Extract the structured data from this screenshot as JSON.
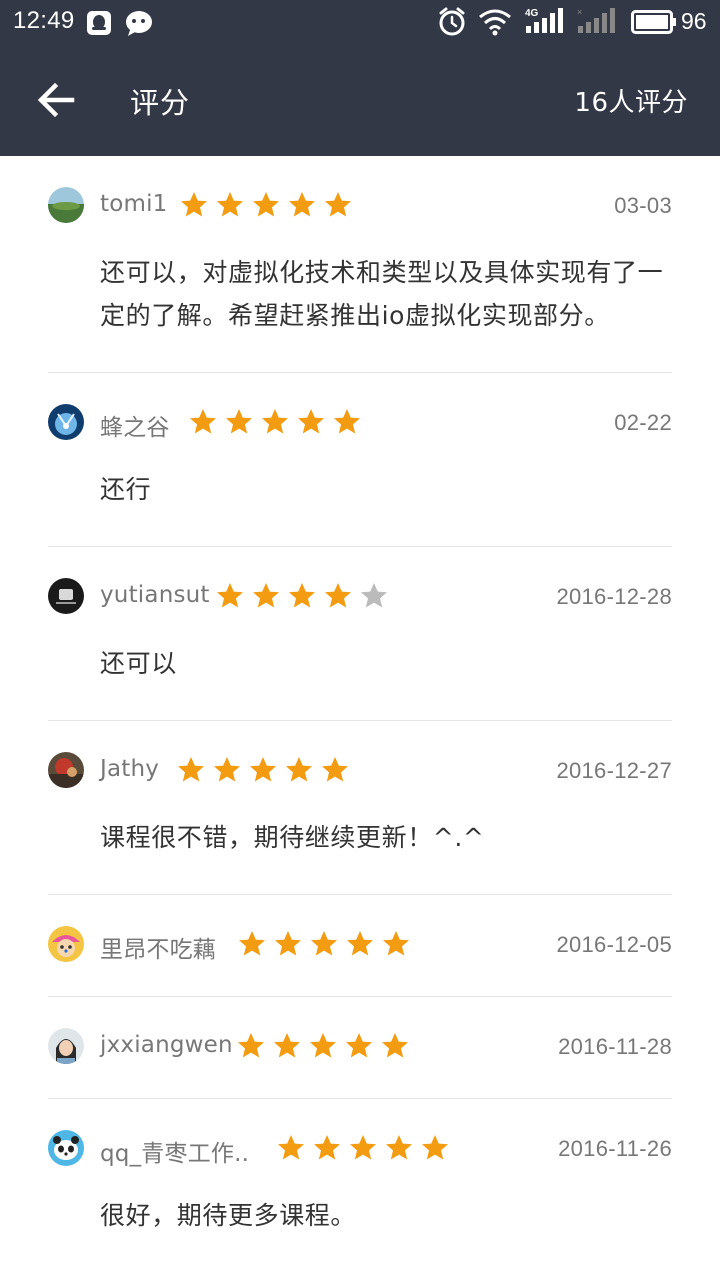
{
  "status_bar": {
    "time": "12:49",
    "battery": "96",
    "icons": [
      "qq-icon",
      "wechat-icon",
      "alarm-icon",
      "wifi-icon",
      "signal-4g-icon",
      "signal-2-icon",
      "battery-icon"
    ]
  },
  "app_bar": {
    "back_icon": "arrow-left-icon",
    "title": "评分",
    "rating_count": "16人评分"
  },
  "colors": {
    "header_bg": "#323845",
    "star_filled": "#f39c12",
    "star_empty": "#bbbbbb",
    "meta_text": "#777777",
    "body_text": "#333333"
  },
  "reviews": [
    {
      "username": "tomi1",
      "rating": 5,
      "date": "03-03",
      "comment": "还可以，对虚拟化技术和类型以及具体实现有了一定的了解。希望赶紧推出io虚拟化实现部分。"
    },
    {
      "username": "蜂之谷",
      "rating": 5,
      "date": "02-22",
      "comment": "还行"
    },
    {
      "username": "yutiansut",
      "rating": 4,
      "date": "2016-12-28",
      "comment": "还可以"
    },
    {
      "username": "Jathy",
      "rating": 5,
      "date": "2016-12-27",
      "comment": "课程很不错，期待继续更新！^.^"
    },
    {
      "username": "里昂不吃藕",
      "rating": 5,
      "date": "2016-12-05",
      "comment": ""
    },
    {
      "username": "jxxiangwen",
      "rating": 5,
      "date": "2016-11-28",
      "comment": ""
    },
    {
      "username": "qq_青枣工作..",
      "rating": 5,
      "date": "2016-11-26",
      "comment": "很好，期待更多课程。"
    }
  ]
}
